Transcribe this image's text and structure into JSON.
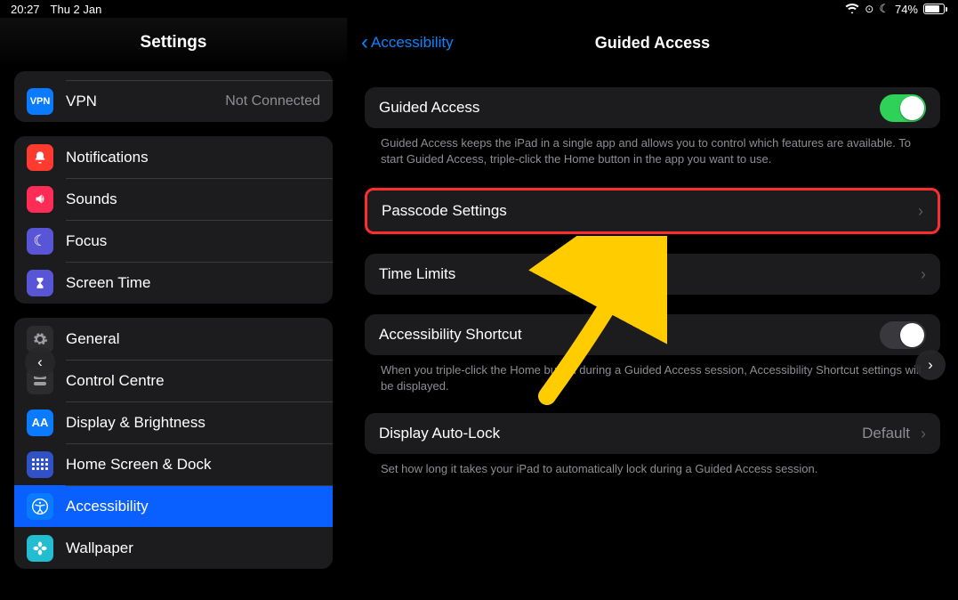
{
  "status": {
    "time": "20:27",
    "date": "Thu 2 Jan",
    "battery_pct_label": "74%",
    "battery_fill_pct": 74
  },
  "sidebar": {
    "title": "Settings",
    "groupTop": {
      "vpn": {
        "label": "VPN",
        "badge": "VPN",
        "trailing": "Not Connected"
      }
    },
    "groupNotif": {
      "notifications": "Notifications",
      "sounds": "Sounds",
      "focus": "Focus",
      "screen_time": "Screen Time"
    },
    "groupGeneral": {
      "general": "General",
      "control_centre": "Control Centre",
      "display": "Display & Brightness",
      "home_screen": "Home Screen & Dock",
      "accessibility": "Accessibility",
      "wallpaper": "Wallpaper"
    }
  },
  "detail": {
    "back_label": "Accessibility",
    "title": "Guided Access",
    "section1": {
      "guided_access": "Guided Access",
      "footer": "Guided Access keeps the iPad in a single app and allows you to control which features are available. To start Guided Access, triple-click the Home button in the app you want to use."
    },
    "section2": {
      "passcode": "Passcode Settings"
    },
    "section3": {
      "time_limits": "Time Limits"
    },
    "section4": {
      "shortcut": "Accessibility Shortcut",
      "footer": "When you triple-click the Home button during a Guided Access session, Accessibility Shortcut settings will be displayed."
    },
    "section5": {
      "auto_lock": "Display Auto-Lock",
      "value": "Default",
      "footer": "Set how long it takes your iPad to automatically lock during a Guided Access session."
    }
  }
}
